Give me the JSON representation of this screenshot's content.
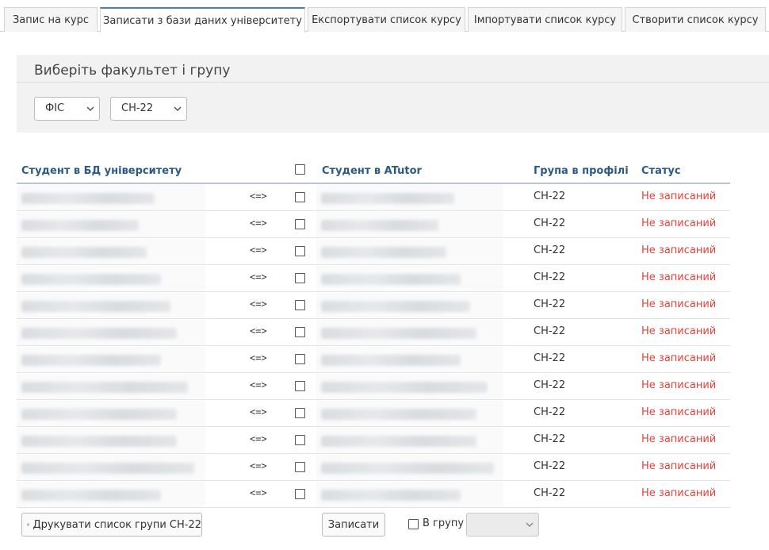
{
  "tabs": [
    {
      "label": "Запис на курс"
    },
    {
      "label": "Записати з бази даних університету"
    },
    {
      "label": "Експортувати список курсу"
    },
    {
      "label": "Імпортувати список курсу"
    },
    {
      "label": "Створити список курсу"
    }
  ],
  "active_tab": "Записати з бази даних університету",
  "filter": {
    "title": "Виберіть факультет і групу",
    "faculty_value": "ФІС",
    "group_value": "СН-22"
  },
  "table": {
    "headers": {
      "db_student": "Студент в БД університету",
      "atutor_student": "Студент в ATutor",
      "profile_group": "Група в профілі",
      "status": "Статус"
    },
    "arrow_symbol": "<=>",
    "rows": [
      {
        "group": "СН-22",
        "status": "Не записаний"
      },
      {
        "group": "СН-22",
        "status": "Не записаний"
      },
      {
        "group": "СН-22",
        "status": "Не записаний"
      },
      {
        "group": "СН-22",
        "status": "Не записаний"
      },
      {
        "group": "СН-22",
        "status": "Не записаний"
      },
      {
        "group": "СН-22",
        "status": "Не записаний"
      },
      {
        "group": "СН-22",
        "status": "Не записаний"
      },
      {
        "group": "СН-22",
        "status": "Не записаний"
      },
      {
        "group": "СН-22",
        "status": "Не записаний"
      },
      {
        "group": "СН-22",
        "status": "Не записаний"
      },
      {
        "group": "СН-22",
        "status": "Не записаний"
      },
      {
        "group": "СН-22",
        "status": "Не записаний"
      }
    ]
  },
  "footer": {
    "print_button": "Друкувати список групи СН-22",
    "enroll_button": "Записати",
    "to_group_label": "В групу",
    "group_select_value": ""
  },
  "colors": {
    "header_text": "#2b5a87",
    "status_not_enrolled": "#e3423a",
    "active_tab_accent": "#4a7fb3"
  }
}
